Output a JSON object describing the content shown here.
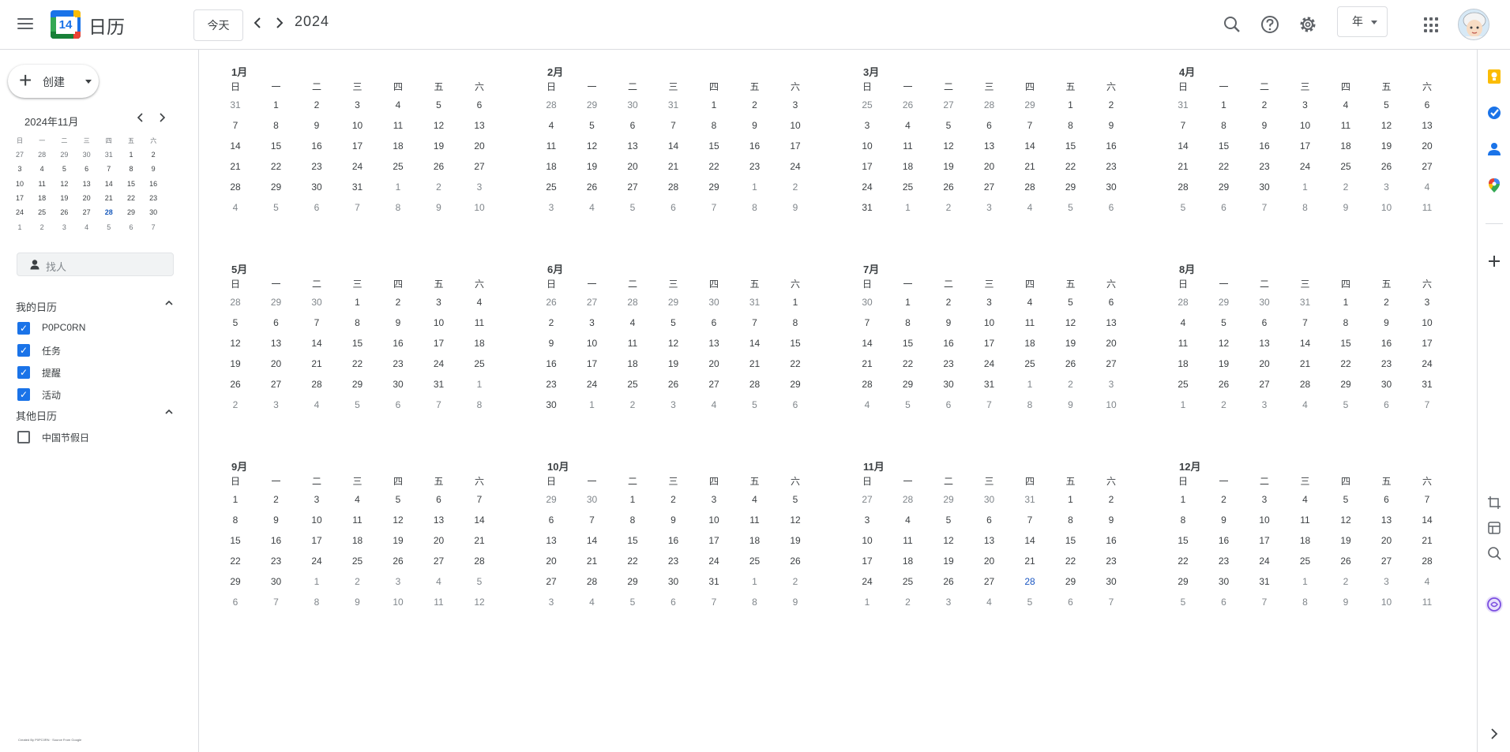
{
  "header": {
    "menu_icon": "menu-icon",
    "logo_number": "14",
    "app_title": "日历",
    "today_label": "今天",
    "prev_icon": "<",
    "next_icon": ">",
    "year": "2024",
    "view_label": "年",
    "icons": [
      "search-icon",
      "help-icon",
      "settings-icon",
      "apps-icon",
      "avatar"
    ]
  },
  "sidebar": {
    "create_label": "创建",
    "mini_calendar": {
      "title": "2024年11月",
      "prev": "<",
      "next": ">",
      "weekdays": [
        "日",
        "一",
        "二",
        "三",
        "四",
        "五",
        "六"
      ],
      "weeks": [
        [
          "27",
          "28",
          "29",
          "30",
          "31",
          "1",
          "2"
        ],
        [
          "3",
          "4",
          "5",
          "6",
          "7",
          "8",
          "9"
        ],
        [
          "10",
          "11",
          "12",
          "13",
          "14",
          "15",
          "16"
        ],
        [
          "17",
          "18",
          "19",
          "20",
          "21",
          "22",
          "23"
        ],
        [
          "24",
          "25",
          "26",
          "27",
          "28",
          "29",
          "30"
        ],
        [
          "1",
          "2",
          "3",
          "4",
          "5",
          "6",
          "7"
        ]
      ],
      "today": "28"
    },
    "search_people_placeholder": "找人",
    "my_calendars_title": "我的日历",
    "my_calendars": [
      {
        "label": "P0PC0RN",
        "checked": true
      },
      {
        "label": "任务",
        "checked": true
      },
      {
        "label": "提醒",
        "checked": true
      },
      {
        "label": "活动",
        "checked": true
      }
    ],
    "other_calendars_title": "其他日历",
    "other_calendars": [
      {
        "label": "中国节假日",
        "checked": false
      }
    ],
    "footer": "Created By P0PC0RN · Source From Google"
  },
  "year_view": {
    "weekdays": [
      "日",
      "一",
      "二",
      "三",
      "四",
      "五",
      "六"
    ],
    "today_month": 10,
    "today_day": "28",
    "months": [
      {
        "title": "1月",
        "lead": [
          "31"
        ],
        "days": 31
      },
      {
        "title": "2月",
        "lead": [
          "28",
          "29",
          "30",
          "31"
        ],
        "days": 29
      },
      {
        "title": "3月",
        "lead": [
          "25",
          "26",
          "27",
          "28",
          "29"
        ],
        "days": 31
      },
      {
        "title": "4月",
        "lead": [
          "31"
        ],
        "days": 30
      },
      {
        "title": "5月",
        "lead": [
          "28",
          "29",
          "30"
        ],
        "days": 31
      },
      {
        "title": "6月",
        "lead": [
          "26",
          "27",
          "28",
          "29",
          "30",
          "31"
        ],
        "days": 30
      },
      {
        "title": "7月",
        "lead": [
          "30"
        ],
        "days": 31
      },
      {
        "title": "8月",
        "lead": [
          "28",
          "29",
          "30",
          "31"
        ],
        "days": 31
      },
      {
        "title": "9月",
        "lead": [],
        "days": 30
      },
      {
        "title": "10月",
        "lead": [
          "29",
          "30"
        ],
        "days": 31
      },
      {
        "title": "11月",
        "lead": [
          "27",
          "28",
          "29",
          "30",
          "31"
        ],
        "days": 30
      },
      {
        "title": "12月",
        "lead": [],
        "days": 31
      }
    ]
  },
  "right_rail": {
    "icons": [
      "keep-icon",
      "tasks-icon",
      "contacts-icon",
      "maps-icon",
      "add-icon",
      "crop-icon",
      "table-icon",
      "search-icon",
      "brain-icon",
      "chevron-right-icon"
    ]
  }
}
